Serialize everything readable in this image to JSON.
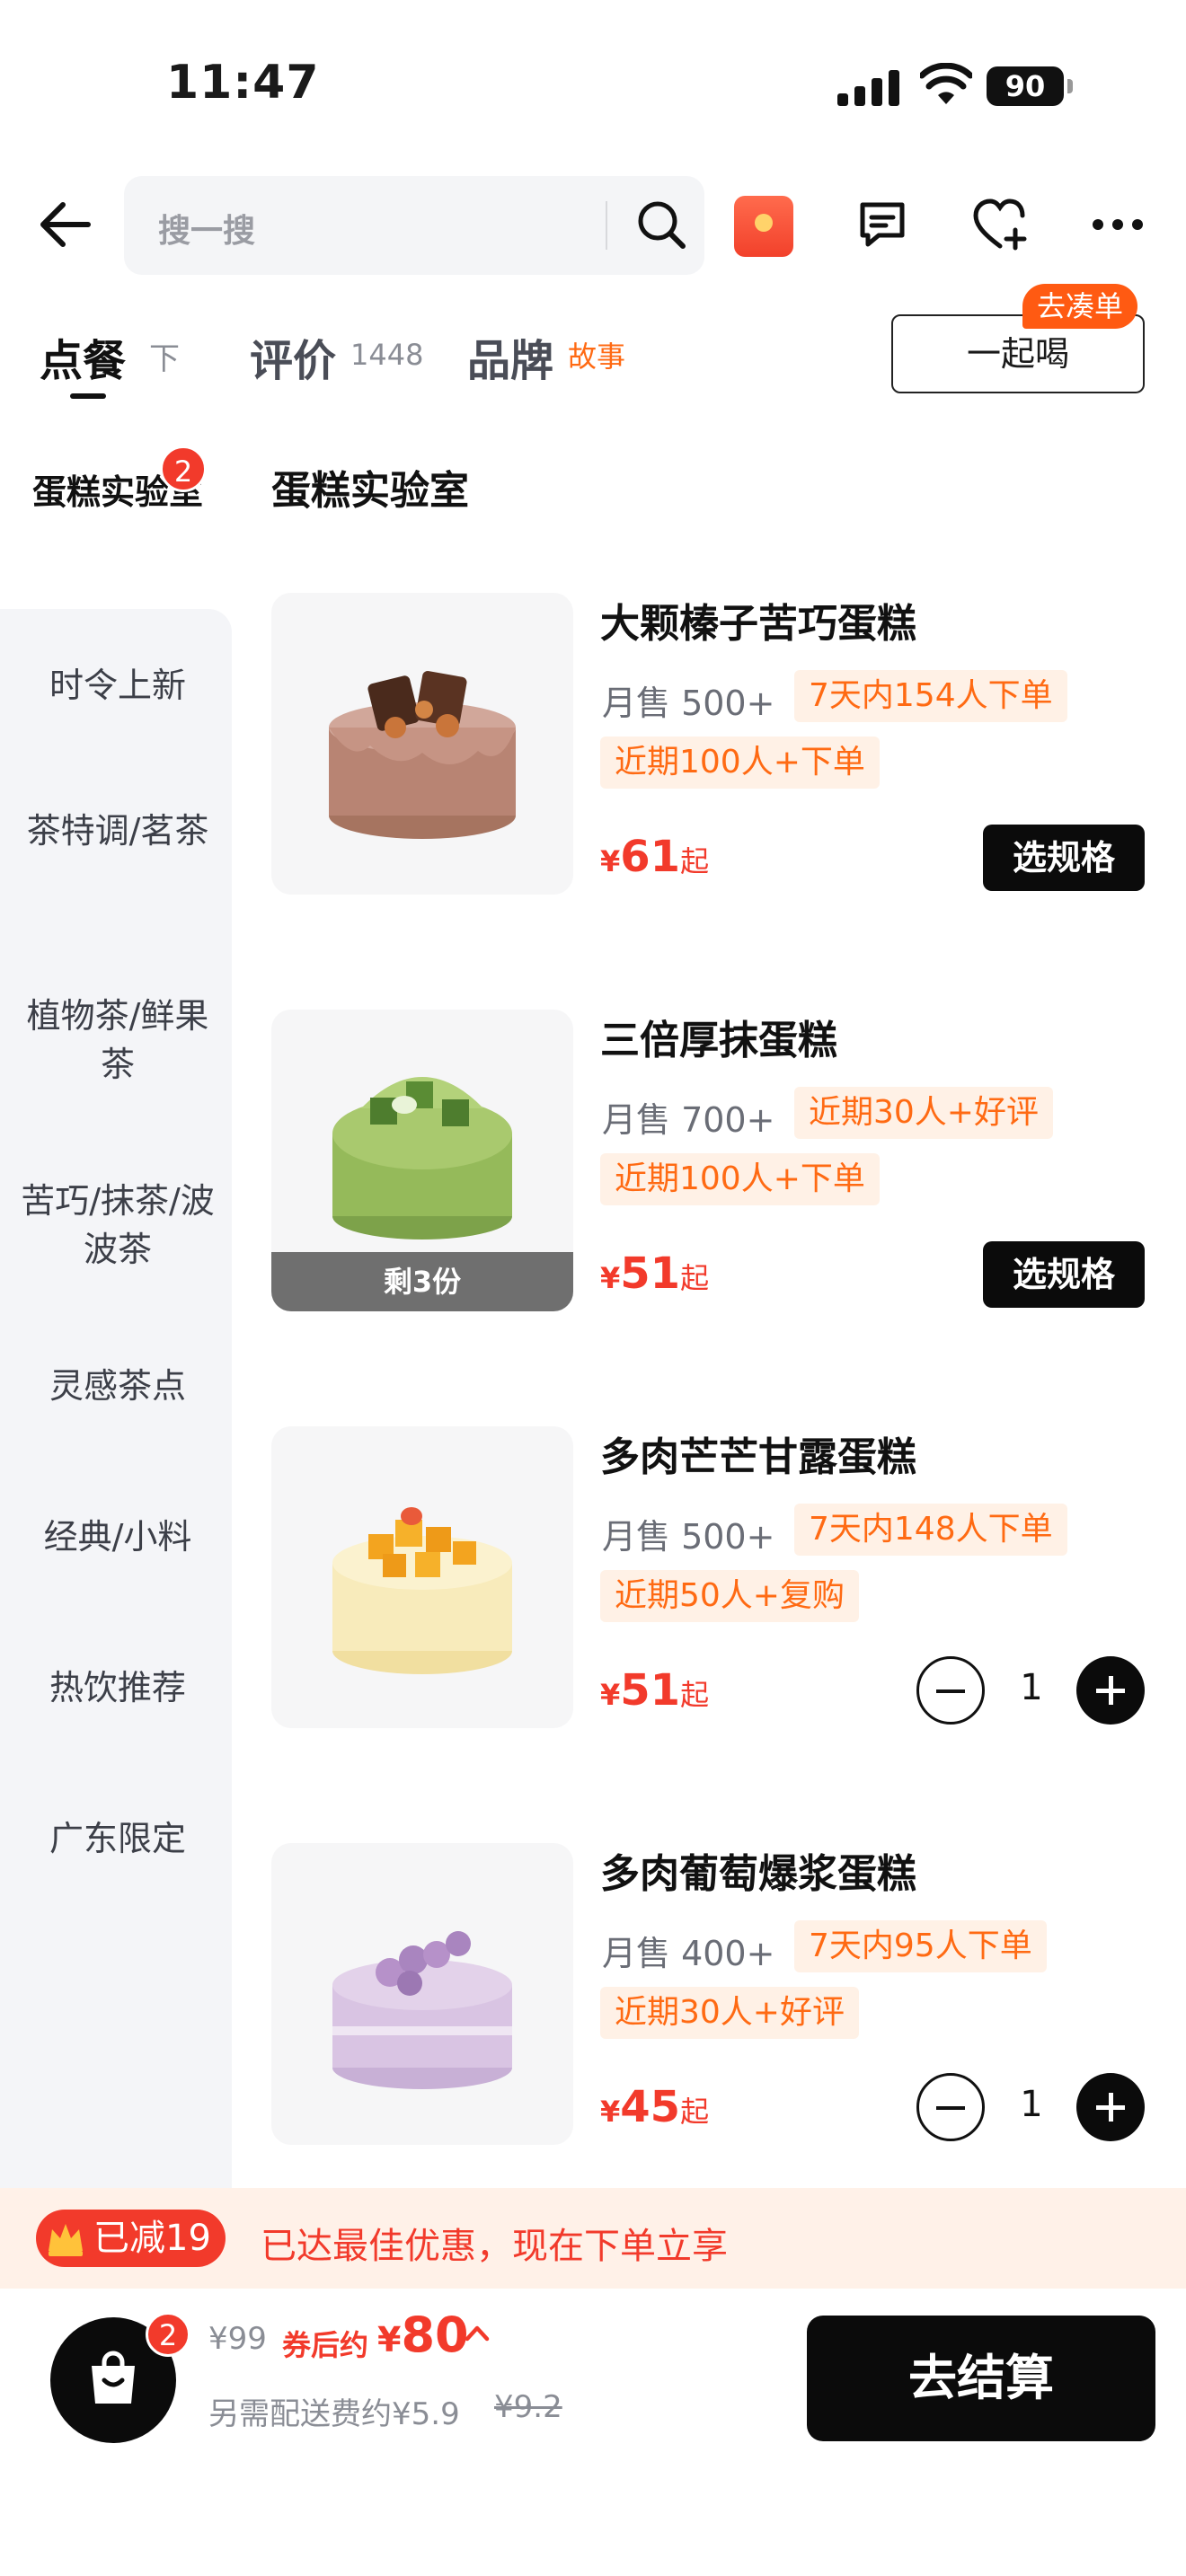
{
  "status_bar": {
    "time": "11:47",
    "battery": "90"
  },
  "search": {
    "placeholder": "搜一搜"
  },
  "tabs": {
    "order": "点餐",
    "pin": "下",
    "review": "评价",
    "review_count": "1448",
    "brand": "品牌",
    "brand_story": "故事"
  },
  "group_order": {
    "label": "一起喝",
    "tag": "去凑单"
  },
  "sidebar": {
    "active": {
      "label": "蛋糕实验室",
      "badge": "2"
    },
    "items": [
      {
        "label": "时令上新"
      },
      {
        "label": "茶特调/茗茶"
      },
      {
        "label": "植物茶/鲜果茶"
      },
      {
        "label": "苦巧/抹茶/波波茶"
      },
      {
        "label": "灵感茶点"
      },
      {
        "label": "经典/小料"
      },
      {
        "label": "热饮推荐"
      },
      {
        "label": "广东限定"
      }
    ]
  },
  "section_title": "蛋糕实验室",
  "products": [
    {
      "name": "大颗榛子苦巧蛋糕",
      "sales": "月售 500+",
      "tag1": "7天内154人下单",
      "tag2": "近期100人+下单",
      "currency": "¥",
      "price": "61",
      "price_suffix": "起",
      "action": "选规格"
    },
    {
      "name": "三倍厚抹蛋糕",
      "sales": "月售 700+",
      "tag1": "近期30人+好评",
      "tag2": "近期100人+下单",
      "currency": "¥",
      "price": "51",
      "price_suffix": "起",
      "action": "选规格",
      "stock": "剩3份"
    },
    {
      "name": "多肉芒芒甘露蛋糕",
      "sales": "月售 500+",
      "tag1": "7天内148人下单",
      "tag2": "近期50人+复购",
      "currency": "¥",
      "price": "51",
      "price_suffix": "起",
      "quantity": "1"
    },
    {
      "name": "多肉葡萄爆浆蛋糕",
      "sales": "月售 400+",
      "tag1": "7天内95人下单",
      "tag2": "近期30人+好评",
      "currency": "¥",
      "price": "45",
      "price_suffix": "起",
      "quantity": "1"
    }
  ],
  "promo": {
    "pill": "已减19",
    "text": "已达最佳优惠，现在下单立享"
  },
  "cart": {
    "badge": "2",
    "original_price": "¥99",
    "coupon_label": "券后约",
    "currency": "¥",
    "final_price": "80",
    "delivery": "另需配送费约¥5.9",
    "delivery_original": "¥9.2",
    "checkout": "去结算"
  },
  "colors": {
    "accent_red": "#f23a2b",
    "accent_orange": "#ff6a13",
    "tag_bg": "#fff1e6",
    "dark": "#0b0b0b"
  }
}
